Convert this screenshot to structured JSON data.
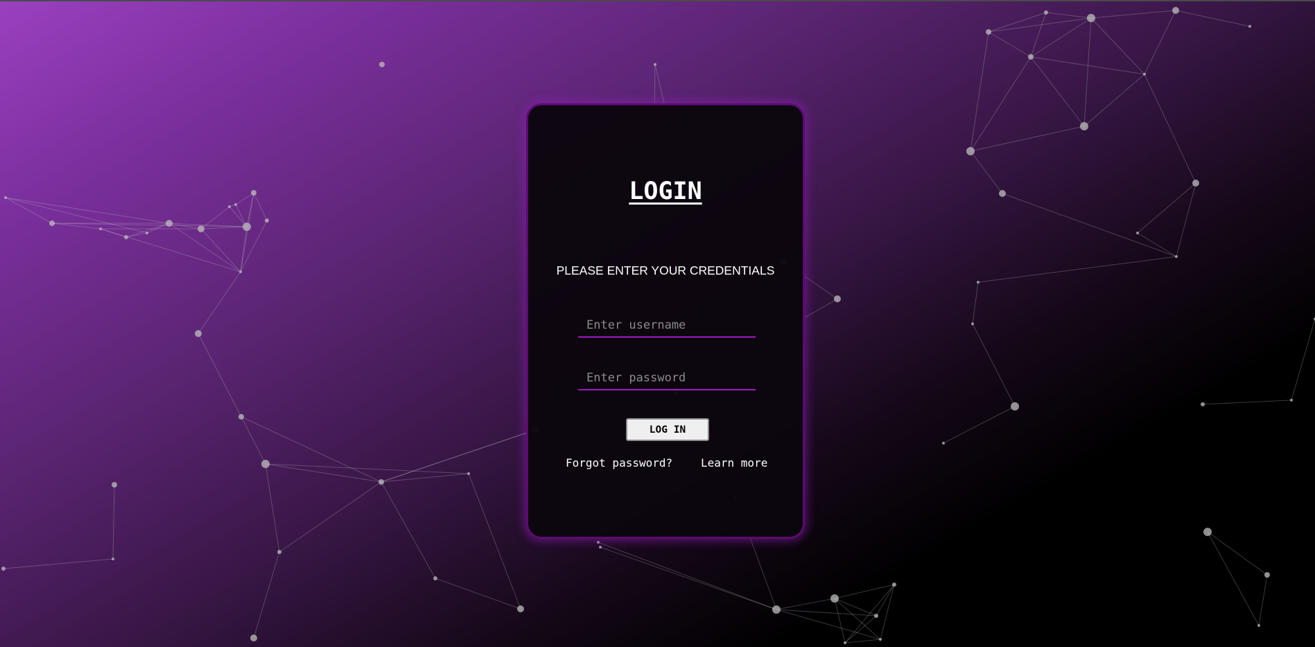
{
  "page": {
    "background_gradient": [
      "#9a40c0",
      "#5c2574",
      "#000000"
    ],
    "accent_color": "#a019c0"
  },
  "login_card": {
    "title": "LOGIN",
    "subtitle": "PLEASE ENTER YOUR CREDENTIALS",
    "username": {
      "value": "",
      "placeholder": "Enter username"
    },
    "password": {
      "value": "",
      "placeholder": "Enter password"
    },
    "login_button_label": "LOG IN",
    "forgot_password_label": "Forgot password?",
    "learn_more_label": "Learn more"
  }
}
